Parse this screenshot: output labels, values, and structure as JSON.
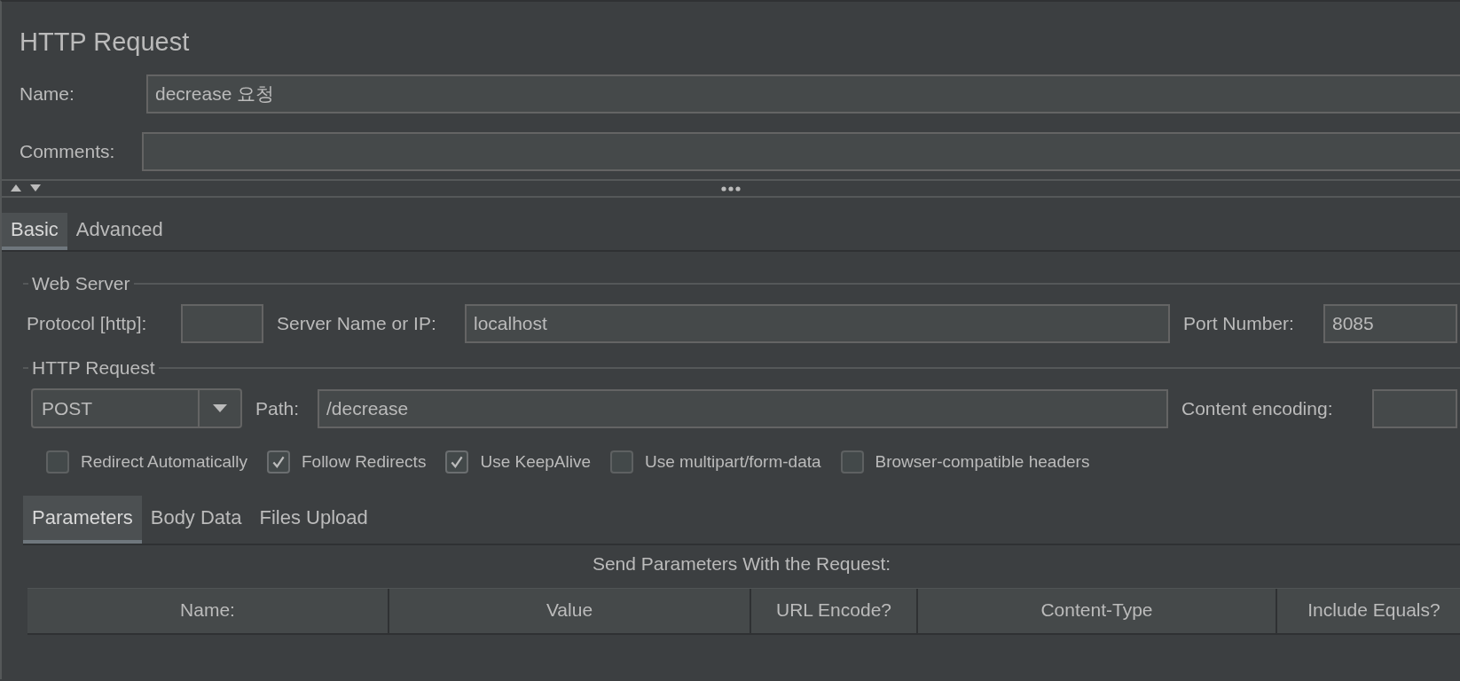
{
  "title": "HTTP Request",
  "name_field": {
    "label": "Name:",
    "value": "decrease 요청"
  },
  "comments_field": {
    "label": "Comments:"
  },
  "tabs": [
    {
      "label": "Basic",
      "selected": true
    },
    {
      "label": "Advanced",
      "selected": false
    }
  ],
  "web_server": {
    "title": "Web Server",
    "protocol": {
      "label": "Protocol [http]:"
    },
    "server": {
      "label": "Server Name or IP:",
      "value": "localhost"
    },
    "port": {
      "label": "Port Number:",
      "value": "8085"
    }
  },
  "http_request": {
    "title": "HTTP Request",
    "method": {
      "value": "POST"
    },
    "path": {
      "label": "Path:",
      "value": "/decrease"
    },
    "content_encoding": {
      "label": "Content encoding:"
    }
  },
  "options": [
    {
      "label": "Redirect Automatically",
      "checked": false
    },
    {
      "label": "Follow Redirects",
      "checked": true
    },
    {
      "label": "Use KeepAlive",
      "checked": true
    },
    {
      "label": "Use multipart/form-data",
      "checked": false
    },
    {
      "label": "Browser-compatible headers",
      "checked": false
    }
  ],
  "sub_tabs": [
    {
      "label": "Parameters",
      "selected": true
    },
    {
      "label": "Body Data",
      "selected": false
    },
    {
      "label": "Files Upload",
      "selected": false
    }
  ],
  "parameters": {
    "caption": "Send Parameters With the Request:",
    "columns": [
      "Name:",
      "Value",
      "URL Encode?",
      "Content-Type",
      "Include Equals?"
    ]
  }
}
